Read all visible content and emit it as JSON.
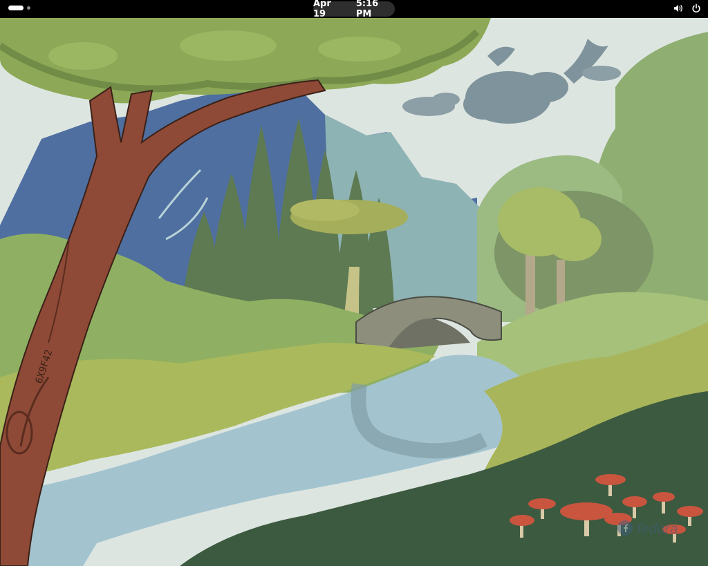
{
  "top_bar": {
    "date": "Apr 19",
    "time": "5:16 PM",
    "activities_icon": "workspace-indicator-icon",
    "volume_icon": "volume-icon",
    "power_icon": "power-icon"
  },
  "desktop": {
    "wallpaper": "forest-river-bridge-illustration",
    "watermark_text": "fedora",
    "watermark_icon": "fedora-logo-icon",
    "trunk_carving": "6X9F42"
  },
  "colors": {
    "top_bar_bg": "#000000",
    "clock_pill_bg": "#2e2e2e",
    "sky": "#dde5e1",
    "river": "#a3c4cf",
    "mushroom": "#c9553f"
  }
}
